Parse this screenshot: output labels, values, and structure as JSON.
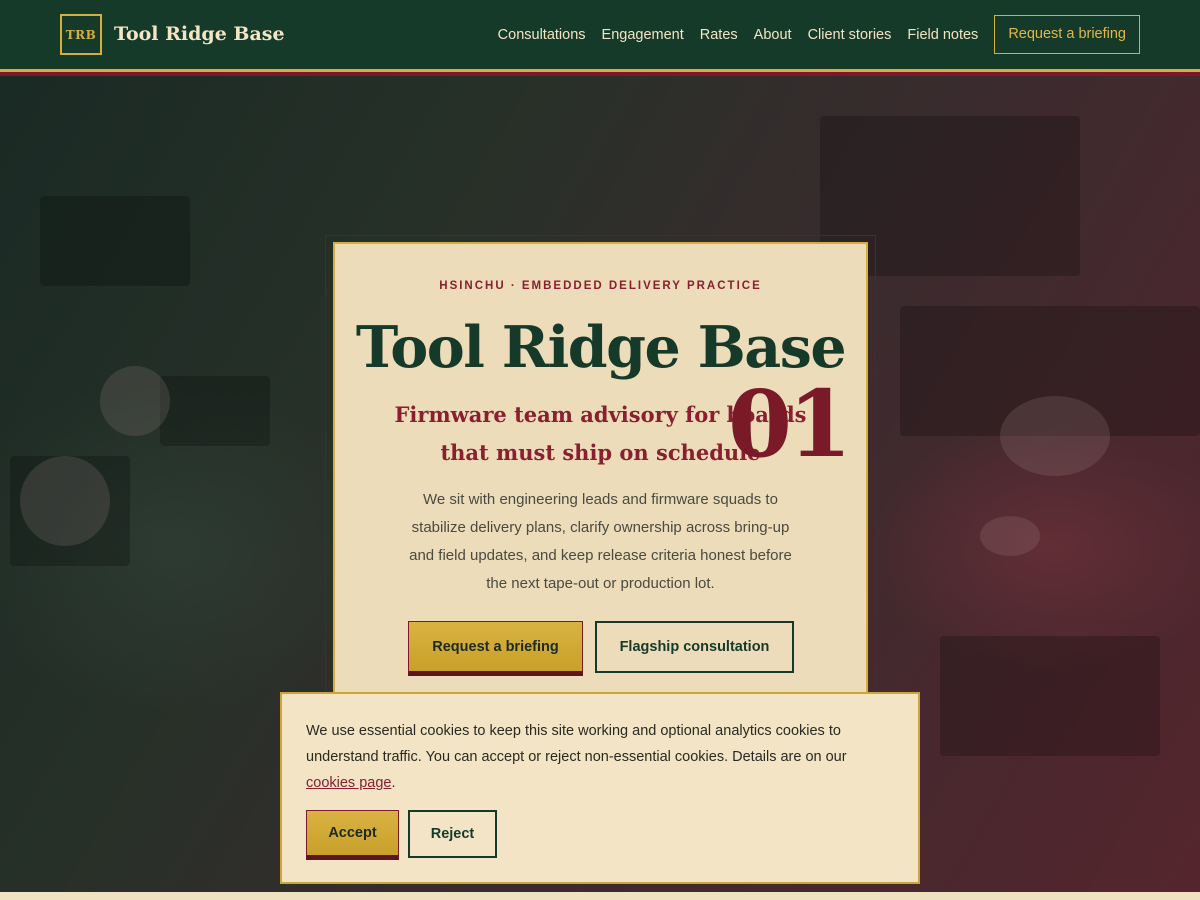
{
  "brand": {
    "logo_text": "TRB",
    "name": "Tool Ridge Base"
  },
  "nav": {
    "items": [
      {
        "label": "Consultations"
      },
      {
        "label": "Engagement"
      },
      {
        "label": "Rates"
      },
      {
        "label": "About"
      },
      {
        "label": "Client stories"
      },
      {
        "label": "Field notes"
      }
    ],
    "cta_label": "Request a briefing"
  },
  "hero": {
    "eyebrow": "HSINCHU · EMBEDDED DELIVERY PRACTICE",
    "title": "Tool Ridge Base",
    "subtitle": "Firmware team advisory for boards that must ship on schedule",
    "number": "01",
    "body": "We sit with engineering leads and firmware squads to stabilize delivery plans, clarify ownership across bring-up and field updates, and keep release criteria honest before the next tape-out or production lot.",
    "primary_button": "Request a briefing",
    "secondary_button": "Flagship consultation"
  },
  "cookie_banner": {
    "text": "We use essential cookies to keep this site working and optional analytics cookies to understand traffic. You can accept or reject non-essential cookies. Details are on our ",
    "link_text": "cookies page",
    "trailing": ".",
    "accept_label": "Accept",
    "reject_label": "Reject"
  },
  "colors": {
    "header_bg": "#163a2a",
    "gold": "#d8ad3c",
    "burgundy": "#8a1f30",
    "cream": "#ecdcba"
  }
}
